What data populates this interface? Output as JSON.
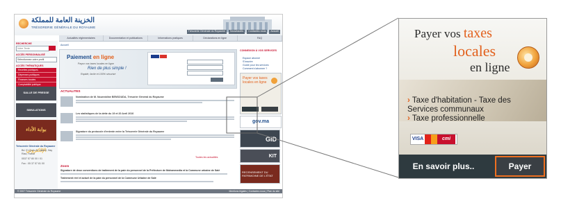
{
  "site": {
    "logo_ar": "الخزينة العامة للمملكة",
    "logo_fr": "TRÉSORERIE GÉNÉRALE DU ROYAUME",
    "top_links": [
      "Trésorerie Générale du Royaume",
      "Nouveautés",
      "Contactez-nous",
      "Accueil"
    ],
    "nav": [
      "Actualités réglementaires",
      "Documentation et publications",
      "Informations pratiques",
      "Déclarations en ligne",
      "FAQ"
    ],
    "sidebar": {
      "search_heading": "RECHERCHE",
      "search_placeholder": "Votre Texte",
      "profile_heading": "ACCÈS PERSONNALISÉ",
      "profile_value": "Sélectionnez votre profil",
      "thematic_heading": "ACCÈS THÉMATIQUES",
      "thematic_items": [
        "Recettes publiques",
        "Dépenses publiques",
        "Finances locales",
        "Comptabilité publique"
      ],
      "box_press": "SALLE DE PRESSE",
      "box_sim": "SIMULATIONS",
      "box_ar": "بوابة الأداء الإلكتروني",
      "address_heading": "Trésorerie Générale du Royaume",
      "address_lines": [
        "Bd. El Qods Av. Nakhil, Hay Riad, Rabat",
        "0537 57 80 00 / 01",
        "Fax : 05 37 57 81 00"
      ]
    },
    "breadcrumb": "Accueil",
    "banner": {
      "title_1": "Paiement",
      "title_2": "en ligne",
      "subtitle": "Payez vos taxes locales en ligne",
      "slogan": "Rien de plus simple !",
      "tagline": "Rapide, facile et 100% sécurisé"
    },
    "news_heading": "ACTUALITES",
    "news": [
      {
        "title": "Nomination de M. Noureddine BENSOUDA, Trésorier Général du Royaume"
      },
      {
        "title": "Les statistiques de la dette du 19 et 20 Avril 2010"
      },
      {
        "title": "Signature du protocole d'entente entre la Trésorerie Générale du Royaume"
      }
    ],
    "more_news": "Toutes les actualités",
    "focus_heading": "Zoom",
    "focus_lines": [
      "Signature de deux conventions de traitement de la paie du personnel de la Préfecture de Mohammedia et la Commune urbaine de Salé",
      "Traitement réel et actuel de la paie du personnel de la Commune Urbaine de Salé"
    ],
    "right_col": {
      "connect_heading": "CONNEXION À VOS SERVICES",
      "links": [
        "Espace abonné",
        "S'inscrire",
        "Guide pour les services",
        "Comment s'abonner ?"
      ],
      "ad_small": "Payer vos taxes locales en ligne",
      "gov": "gov.ma",
      "gid": "GID",
      "recensement": "RECENSEMENT DU PATRIMOINE DE L'ÉTAT",
      "kit": "KIT"
    },
    "footer": "© 2007 Trésorerie Générale du Royaume",
    "footer_right": "Mentions légales | Contactez-nous | Plan du site"
  },
  "ad": {
    "line1_a": "Payer vos ",
    "line1_b": "taxes",
    "line2": "locales",
    "line3": "en ligne",
    "items": [
      "Taxe d'habitation - Taxe des Services communaux",
      "Taxe professionnelle"
    ],
    "cards": [
      "VISA",
      "",
      "cmi"
    ],
    "btn_more": "En savoir plus..",
    "btn_pay": "Payer"
  },
  "colors": {
    "accent": "#e2601c",
    "highlight_border": "#f07020",
    "button_bg": "#2e3a3f",
    "site_red": "#c8102e"
  }
}
